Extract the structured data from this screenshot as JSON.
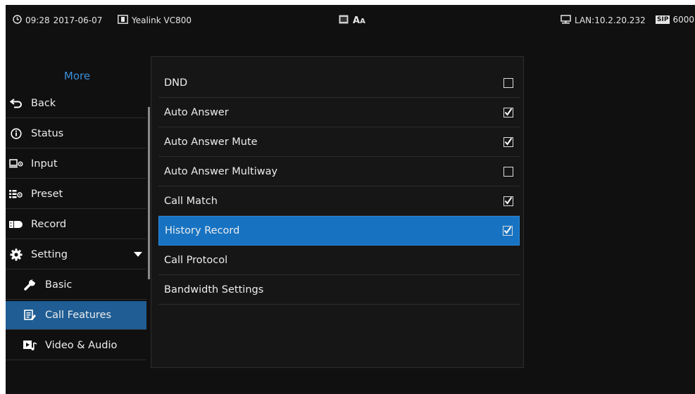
{
  "status_bar": {
    "time": "09:28",
    "date": "2017-06-07",
    "device_name": "Yealink VC800",
    "lan": "LAN:10.2.20.232",
    "sip_badge": "SIP",
    "sip_account": "6000",
    "center_icons": [
      "video-call-icon",
      "font-size-icon"
    ]
  },
  "sidebar": {
    "title": "More",
    "items": [
      {
        "label": "Back",
        "icon": "back-arrow-icon"
      },
      {
        "label": "Status",
        "icon": "info-icon"
      },
      {
        "label": "Input",
        "icon": "input-icon"
      },
      {
        "label": "Preset",
        "icon": "preset-icon"
      },
      {
        "label": "Record",
        "icon": "record-icon"
      },
      {
        "label": "Setting",
        "icon": "gear-icon",
        "expanded": true
      },
      {
        "label": "Basic",
        "icon": "wrench-icon",
        "sub": true
      },
      {
        "label": "Call Features",
        "icon": "call-features-icon",
        "sub": true,
        "active": true
      },
      {
        "label": "Video & Audio",
        "icon": "video-audio-icon",
        "sub": true
      }
    ]
  },
  "settings": [
    {
      "label": "DND",
      "checked": false,
      "has_checkbox": true
    },
    {
      "label": "Auto Answer",
      "checked": true,
      "has_checkbox": true
    },
    {
      "label": "Auto Answer Mute",
      "checked": true,
      "has_checkbox": true
    },
    {
      "label": "Auto Answer Multiway",
      "checked": false,
      "has_checkbox": true
    },
    {
      "label": "Call Match",
      "checked": true,
      "has_checkbox": true
    },
    {
      "label": "History Record",
      "checked": true,
      "has_checkbox": true,
      "selected": true
    },
    {
      "label": "Call Protocol",
      "has_checkbox": false
    },
    {
      "label": "Bandwidth Settings",
      "has_checkbox": false
    }
  ],
  "colors": {
    "background": "#101010",
    "accent": "#1773c2",
    "title_blue": "#3b8fd8",
    "active_sidebar": "#1f5d94"
  }
}
